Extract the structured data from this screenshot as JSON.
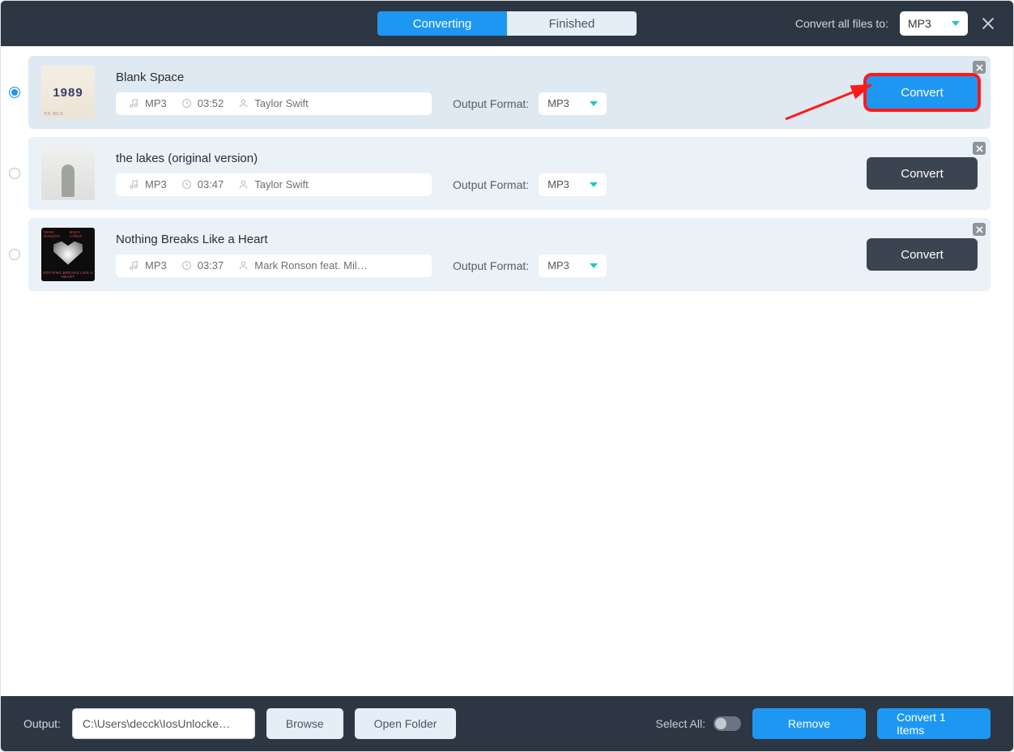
{
  "header": {
    "tabs": {
      "converting": "Converting",
      "finished": "Finished",
      "active": "converting"
    },
    "convert_all_label": "Convert all files to:",
    "global_format": "MP3"
  },
  "items": [
    {
      "title": "Blank Space",
      "format": "MP3",
      "duration": "03:52",
      "artist": "Taylor Swift",
      "output_format_label": "Output Format:",
      "output_format": "MP3",
      "convert_label": "Convert",
      "selected": true,
      "highlighted": true,
      "album_text": "1989"
    },
    {
      "title": "the lakes (original version)",
      "format": "MP3",
      "duration": "03:47",
      "artist": "Taylor Swift",
      "output_format_label": "Output Format:",
      "output_format": "MP3",
      "convert_label": "Convert",
      "selected": false,
      "highlighted": false
    },
    {
      "title": "Nothing Breaks Like a Heart",
      "format": "MP3",
      "duration": "03:37",
      "artist": "Mark Ronson feat. Mil…",
      "output_format_label": "Output Format:",
      "output_format": "MP3",
      "convert_label": "Convert",
      "selected": false,
      "highlighted": false
    }
  ],
  "footer": {
    "output_label": "Output:",
    "output_path": "C:\\Users\\decck\\IosUnlocke…",
    "browse_label": "Browse",
    "open_folder_label": "Open Folder",
    "select_all_label": "Select All:",
    "remove_label": "Remove",
    "convert_items_label": "Convert 1 Items"
  }
}
